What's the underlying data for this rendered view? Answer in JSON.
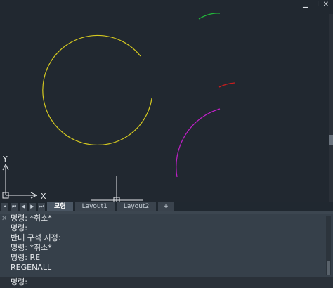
{
  "window_controls": {
    "minimize": "▁",
    "restore": "❐",
    "close": "✕"
  },
  "ucs": {
    "x_label": "X",
    "y_label": "Y"
  },
  "layout_tabs": {
    "nav_buttons": [
      "⏶",
      "⏮",
      "◀",
      "▶",
      "⏭"
    ],
    "tabs": [
      "모형",
      "Layout1",
      "Layout2"
    ],
    "plus": "+"
  },
  "command_line": {
    "close_glyph": "✕",
    "history": [
      "명령: *취소*",
      "명령:",
      "반대 구석 지정:",
      "명령: *취소*",
      "명령: RE",
      "REGENALL"
    ],
    "prompt": "명령:"
  },
  "colors": {
    "background": "#212830",
    "yellow_circle": "#d4c820",
    "green_arc": "#22b83a",
    "red_arc": "#c81e1e",
    "magenta_arc": "#c020c8"
  }
}
